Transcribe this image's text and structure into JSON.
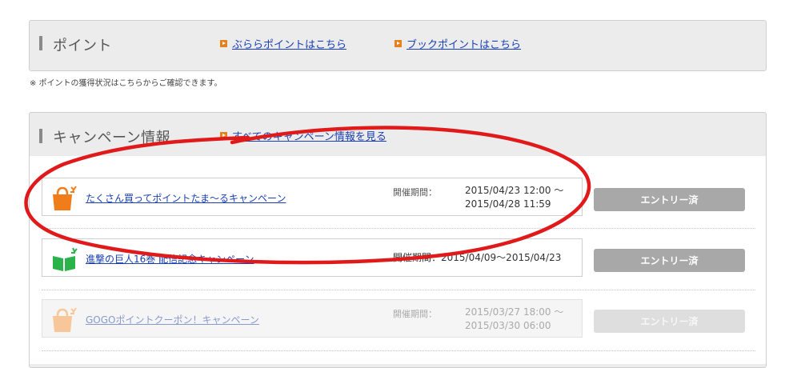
{
  "points_section": {
    "title": "ポイント",
    "links": [
      {
        "label": "ぶららポイントはこちら"
      },
      {
        "label": "ブックポイントはこちら"
      }
    ],
    "note": "※ ポイントの獲得状況はこちらからご確認できます。"
  },
  "campaign_section": {
    "title": "キャンペーン情報",
    "see_all_label": "すべてのキャンペーン情報を見る",
    "items": [
      {
        "name": "たくさん買ってポイントたま～るキャンペーン",
        "icon": "shopping-bag-icon",
        "icon_color": "#f07d1a",
        "period_label": "開催期間：",
        "period_line1": "2015/04/23 12:00 ～",
        "period_line2": "2015/04/28 11:59",
        "button_label": "エントリー済"
      },
      {
        "name": "進撃の巨人16巻 配信記念キャンペーン",
        "icon": "open-book-icon",
        "icon_color": "#2bb34a",
        "period_label": "開催期間：",
        "period_inline": "2015/04/09～2015/04/23",
        "button_label": "エントリー済"
      },
      {
        "name": "GOGOポイントクーポン！キャンペーン",
        "icon": "shopping-bag-icon",
        "icon_color": "#f7c79a",
        "period_label": "開催期間：",
        "period_line1": "2015/03/27 18:00 ～",
        "period_line2": "2015/03/30 06:00",
        "button_label": "エントリー済"
      }
    ]
  },
  "annotation_color": "#e01a1a"
}
